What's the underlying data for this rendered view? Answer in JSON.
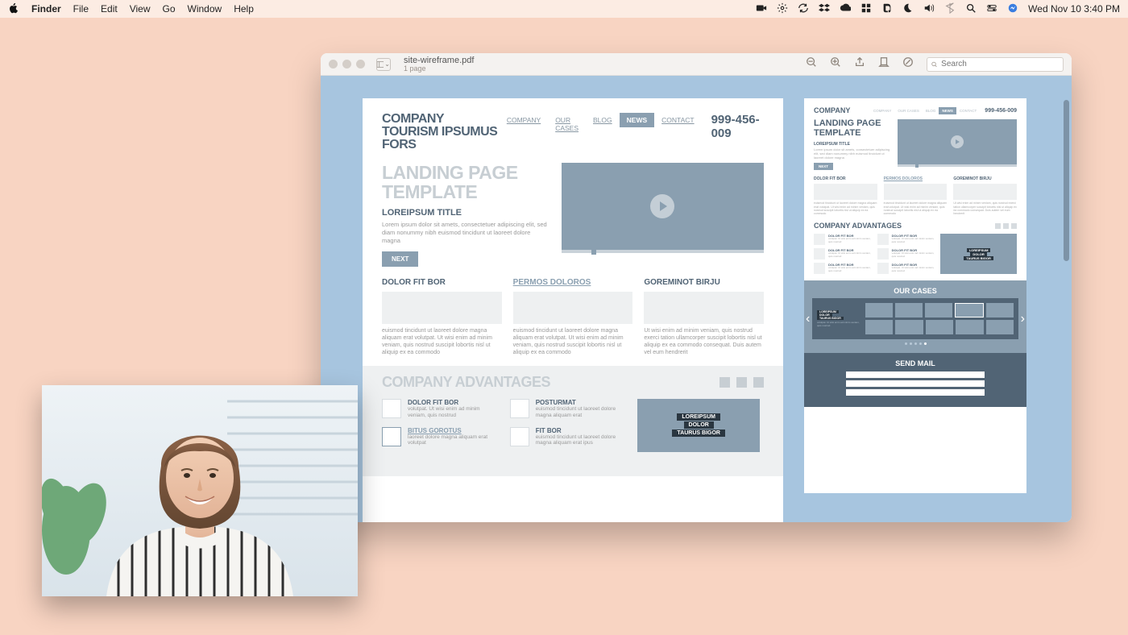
{
  "menubar": {
    "app": "Finder",
    "items": [
      "File",
      "Edit",
      "View",
      "Go",
      "Window",
      "Help"
    ],
    "clock": "Wed Nov 10  3:40 PM"
  },
  "window": {
    "filename": "site-wireframe.pdf",
    "subtitle": "1 page",
    "search_placeholder": "Search"
  },
  "wf": {
    "company": "COMPANY",
    "tagline": "TOURISM IPSUMUS FORS",
    "nav": {
      "company": "COMPANY",
      "cases": "OUR CASES",
      "blog": "BLOG",
      "news": "NEWS",
      "contact": "CONTACT"
    },
    "phone": "999-456-009",
    "hero_title": "LANDING PAGE TEMPLATE",
    "hero_sub": "LOREIPSUM TITLE",
    "hero_body": "Lorem ipsum dolor sit amets, consectetuer adipiscing elit, sed diam nonummy nibh euismod tincidunt ut laoreet dolore magna",
    "next": "NEXT",
    "col1_h": "DOLOR FIT BOR",
    "col2_h": "PERMOS DOLOROS",
    "col3_h": "GOREMINOT BIRJU",
    "col_body1": "euismod tincidunt ut laoreet dolore magna aliquam erat volutpat. Ut wisi enim ad minim veniam, quis nostrud suscipit lobortis nisl ut aliquip ex ea commodo",
    "col_body2": "euismod tincidunt ut laoreet dolore magna aliquam erat volutpat. Ut wisi enim ad minim veniam, quis nostrud suscipit lobortis nisl ut aliquip ex ea commodo",
    "col_body3": "Ut wisi enim ad minim veniam, quis nostrud exerci tation ullamcorper suscipit lobortis nisl ut aliquip ex ea commodo consequat. Duis autem vel eum hendrerit",
    "adv": "COMPANY ADVANTAGES",
    "adv_items": {
      "a": "DOLOR FIT BOR",
      "b": "POSTURMAT",
      "c": "BITUS GOROTUS",
      "d": "FIT BOR"
    },
    "adv_txt_a": "volutpat. Ut wisi enim ad minim veniam, quis nostrud",
    "adv_txt_b": "euismod tincidunt ut laoreet dolore magna aliquam erat",
    "adv_txt_c": "laoreet dolore magna aliquam erat volutpat",
    "adv_txt_d": "euismod tincidunt ut laoreet dolore magna aliquam erat ipus",
    "blk1": "LOREIPSUM",
    "blk2": "DOLOR",
    "blk3": "TAURUS BIGOR",
    "cases": "OUR CASES",
    "mail": "SEND MAIL"
  }
}
